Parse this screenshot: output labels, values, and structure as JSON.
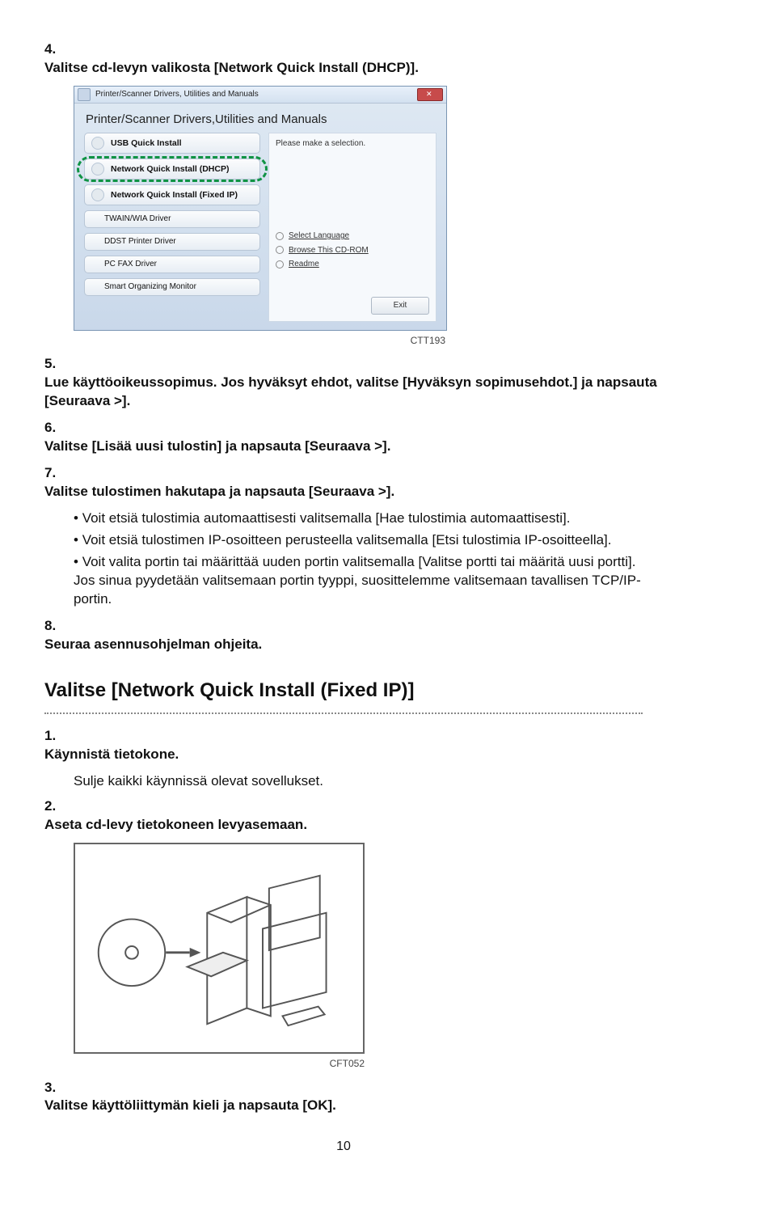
{
  "steps_a": {
    "s4": {
      "n": "4.",
      "t": "Valitse cd-levyn valikosta [Network Quick Install (DHCP)]."
    },
    "s5": {
      "n": "5.",
      "t": "Lue käyttöoikeussopimus. Jos hyväksyt ehdot, valitse [Hyväksyn sopimusehdot.] ja napsauta [Seuraava >]."
    },
    "s6": {
      "n": "6.",
      "t": "Valitse [Lisää uusi tulostin] ja napsauta [Seuraava >]."
    },
    "s7": {
      "n": "7.",
      "t": "Valitse tulostimen hakutapa ja napsauta [Seuraava >]."
    },
    "b1": "Voit etsiä tulostimia automaattisesti valitsemalla [Hae tulostimia automaattisesti].",
    "b2": "Voit etsiä tulostimen IP-osoitteen perusteella valitsemalla [Etsi tulostimia IP-osoitteella].",
    "b3": "Voit valita portin tai määrittää uuden portin valitsemalla [Valitse portti tai määritä uusi portti]. Jos sinua pyydetään valitsemaan portin tyyppi, suosittelemme valitsemaan tavallisen TCP/IP-portin.",
    "s8": {
      "n": "8.",
      "t": "Seuraa asennusohjelman ohjeita."
    }
  },
  "fig1_code": "CTT193",
  "h2": "Valitse [Network Quick Install (Fixed IP)]",
  "steps_b": {
    "s1": {
      "n": "1.",
      "t": "Käynnistä tietokone."
    },
    "s1b": "Sulje kaikki käynnissä olevat sovellukset.",
    "s2": {
      "n": "2.",
      "t": "Aseta cd-levy tietokoneen levyasemaan."
    },
    "s3": {
      "n": "3.",
      "t": "Valitse käyttöliittymän kieli ja napsauta [OK]."
    }
  },
  "fig2_code": "CFT052",
  "page_num": "10",
  "shot1": {
    "titlebar": "Printer/Scanner Drivers, Utilities and Manuals",
    "bigtitle": "Printer/Scanner Drivers,Utilities and Manuals",
    "right_head": "Please make a selection.",
    "left": {
      "usb": "USB Quick Install",
      "dhcp": "Network Quick Install (DHCP)",
      "fixed": "Network Quick Install (Fixed IP)",
      "twain": "TWAIN/WIA Driver",
      "ddst": "DDST Printer Driver",
      "pcfax": "PC FAX Driver",
      "smart": "Smart Organizing Monitor"
    },
    "links": {
      "lang": "Select Language",
      "browse": "Browse This CD-ROM",
      "readme": "Readme"
    },
    "exit": "Exit"
  }
}
